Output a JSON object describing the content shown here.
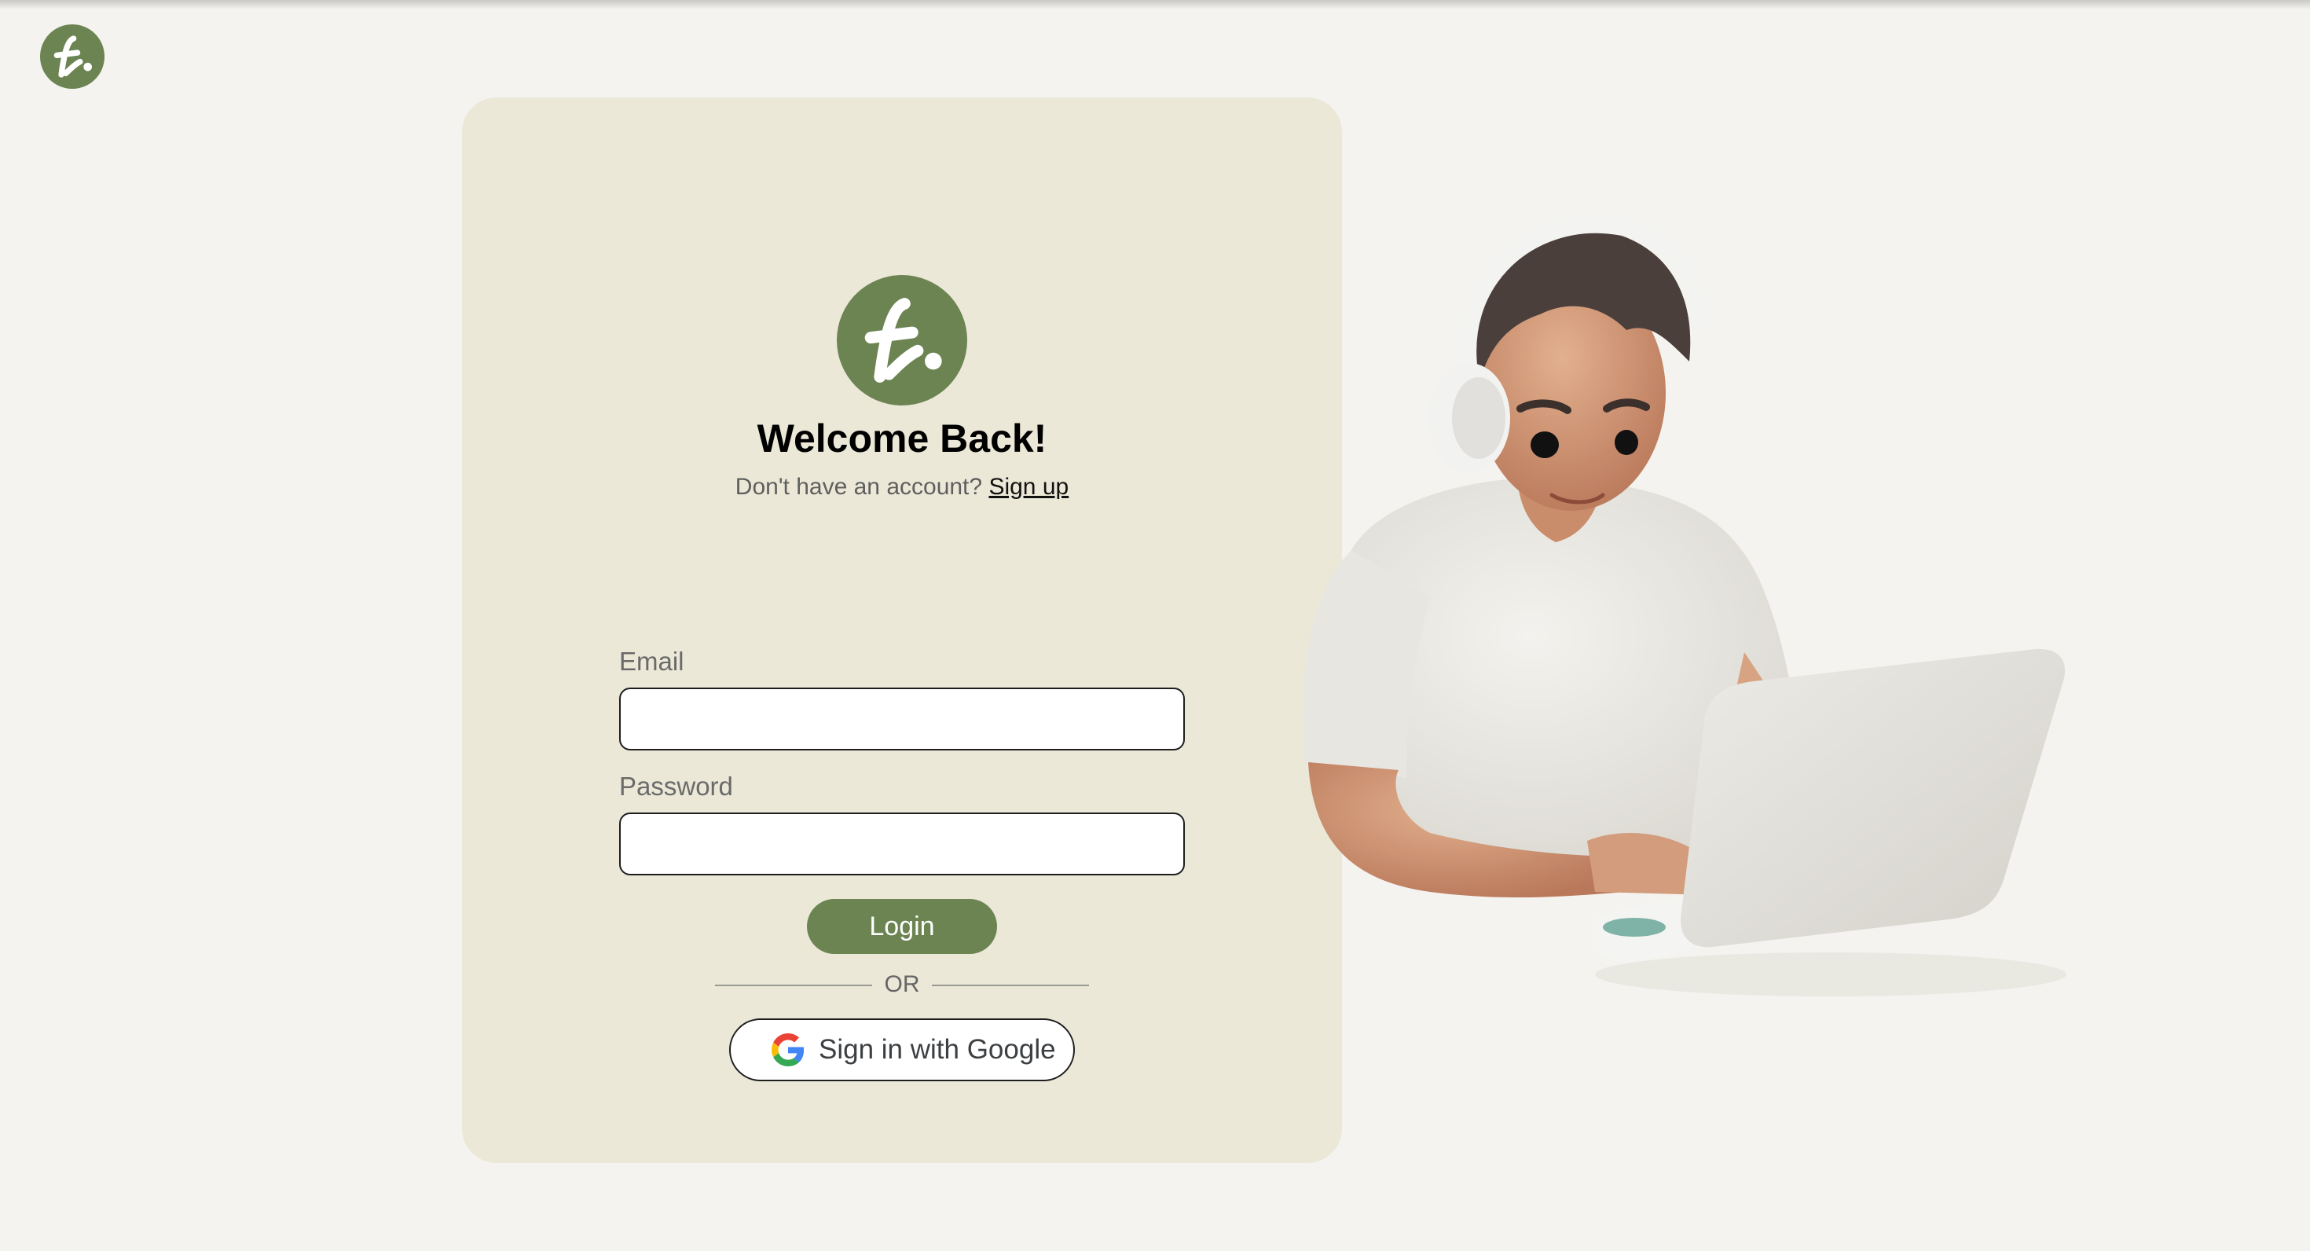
{
  "brand": {
    "logo_letter": "f.",
    "accent_color": "#6b8452"
  },
  "card": {
    "title": "Welcome Back!",
    "signup_prompt": "Don't have an account?",
    "signup_link": "Sign up"
  },
  "form": {
    "email_label": "Email",
    "email_value": "",
    "password_label": "Password",
    "password_value": "",
    "login_label": "Login",
    "divider_label": "OR",
    "google_label": "Sign in with Google"
  },
  "icons": {
    "brand_logo": "brand-logo-icon",
    "google": "google-icon"
  }
}
